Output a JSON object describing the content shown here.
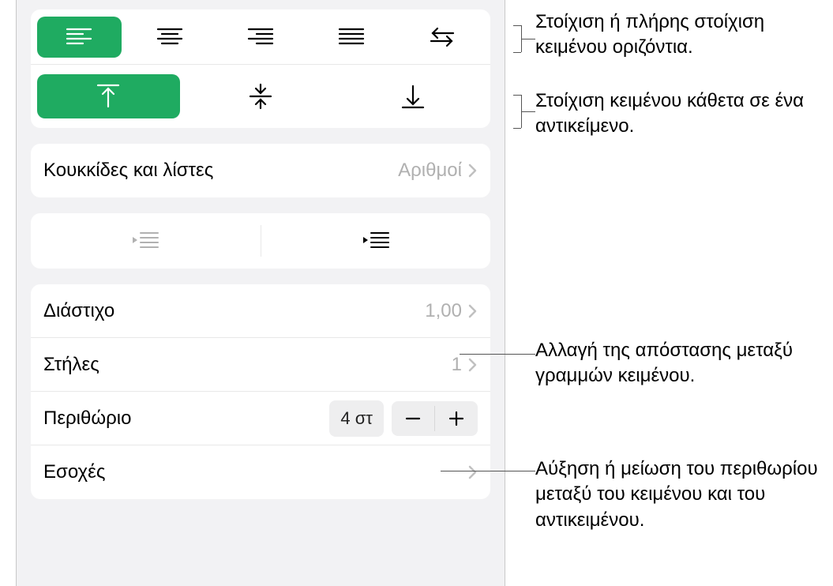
{
  "bullets": {
    "label": "Κουκκίδες και λίστες",
    "value": "Αριθμοί"
  },
  "lineSpacing": {
    "label": "Διάστιχο",
    "value": "1,00"
  },
  "columns": {
    "label": "Στήλες",
    "value": "1"
  },
  "margin": {
    "label": "Περιθώριο",
    "value": "4 στ"
  },
  "indents": {
    "label": "Εσοχές"
  },
  "callouts": {
    "halign": "Στοίχιση ή πλήρης στοίχιση κειμένου οριζόντια.",
    "valign": "Στοίχιση κειμένου κάθετα σε ένα αντικείμενο.",
    "lineSpacing": "Αλλαγή της απόστασης μεταξύ γραμμών κειμένου.",
    "margin": "Αύξηση ή μείωση του περιθωρίου μεταξύ του κειμένου και του αντικειμένου."
  },
  "icons": {
    "alignLeft": "align-left",
    "alignCenter": "align-center",
    "alignRight": "align-right",
    "alignJustify": "align-justify",
    "textDir": "text-direction",
    "valignTop": "valign-top",
    "valignMiddle": "valign-middle",
    "valignBottom": "valign-bottom",
    "outdent": "outdent",
    "indent": "indent"
  }
}
